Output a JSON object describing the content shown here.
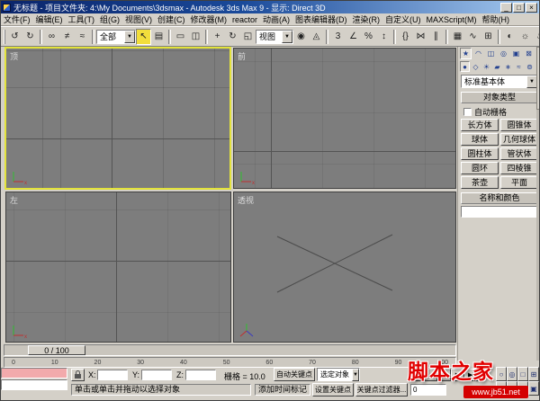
{
  "colors": {
    "titlebar_blue": "#0a246a",
    "active_tool_yellow": "#f2de3c",
    "active_viewport_border": "#e3e33a",
    "viewport_gray": "#7d7d7d",
    "ui_gray": "#d4d0c8",
    "watermark_red": "#d40000"
  },
  "window": {
    "title": "无标题 - 项目文件夹: 4:\\My Documents\\3dsmax - Autodesk 3ds Max 9 - 显示: Direct 3D",
    "minimize": "_",
    "maximize": "□",
    "close": "×"
  },
  "menu": {
    "items": [
      "文件(F)",
      "编辑(E)",
      "工具(T)",
      "组(G)",
      "视图(V)",
      "创建(C)",
      "修改器(M)",
      "reactor",
      "动画(A)",
      "图表编辑器(D)",
      "渲染(R)",
      "自定义(U)",
      "MAXScript(M)",
      "帮助(H)"
    ]
  },
  "toolbar": {
    "selection_filter": "全部",
    "coord_system": "视图",
    "dropdown_arrow": "▼",
    "icons": [
      {
        "name": "undo",
        "glyph": "↺"
      },
      {
        "name": "redo",
        "glyph": "↻"
      },
      {
        "name": "select-and-link",
        "glyph": "∞"
      },
      {
        "name": "unlink-selection",
        "glyph": "≠"
      },
      {
        "name": "bind-to-space-warp",
        "glyph": "≈"
      },
      {
        "name": "select-object",
        "glyph": "↖"
      },
      {
        "name": "select-by-name",
        "glyph": "▤"
      },
      {
        "name": "rectangular-selection-region",
        "glyph": "▭"
      },
      {
        "name": "window-crossing",
        "glyph": "◫"
      },
      {
        "name": "select-and-move",
        "glyph": "+"
      },
      {
        "name": "select-and-rotate",
        "glyph": "↻"
      },
      {
        "name": "select-and-scale",
        "glyph": "◱"
      },
      {
        "name": "use-pivot-point-center",
        "glyph": "◉"
      },
      {
        "name": "select-and-manipulate",
        "glyph": "◬"
      },
      {
        "name": "snap-toggle",
        "glyph": "3"
      },
      {
        "name": "angle-snap",
        "glyph": "∠"
      },
      {
        "name": "percent-snap",
        "glyph": "%"
      },
      {
        "name": "spinner-snap",
        "glyph": "↕"
      },
      {
        "name": "named-selection-sets",
        "glyph": "{}"
      },
      {
        "name": "mirror",
        "glyph": "⋈"
      },
      {
        "name": "align",
        "glyph": "∥"
      },
      {
        "name": "layer-manager",
        "glyph": "▦"
      },
      {
        "name": "curve-editor",
        "glyph": "∿"
      },
      {
        "name": "schematic-view",
        "glyph": "⊞"
      },
      {
        "name": "material-editor",
        "glyph": "◐"
      },
      {
        "name": "render-setup",
        "glyph": "☼"
      },
      {
        "name": "quick-render",
        "glyph": "♨"
      }
    ]
  },
  "viewports": [
    {
      "label": "顶"
    },
    {
      "label": "前"
    },
    {
      "label": "左"
    },
    {
      "label": "透视"
    }
  ],
  "command_panel": {
    "tabs": [
      {
        "name": "create",
        "glyph": "★"
      },
      {
        "name": "modify",
        "glyph": "◠"
      },
      {
        "name": "hierarchy",
        "glyph": "◫"
      },
      {
        "name": "motion",
        "glyph": "◎"
      },
      {
        "name": "display",
        "glyph": "▣"
      },
      {
        "name": "utilities",
        "glyph": "⊠"
      }
    ],
    "categories": [
      {
        "name": "geometry",
        "glyph": "●"
      },
      {
        "name": "shapes",
        "glyph": "◇"
      },
      {
        "name": "lights",
        "glyph": "☀"
      },
      {
        "name": "cameras",
        "glyph": "▰"
      },
      {
        "name": "helpers",
        "glyph": "∗"
      },
      {
        "name": "space-warps",
        "glyph": "≈"
      },
      {
        "name": "systems",
        "glyph": "⊚"
      }
    ],
    "category_dropdown": "标准基本体",
    "object_type_header": "对象类型",
    "autogrid_label": "自动栅格",
    "object_buttons": [
      "长方体",
      "圆锥体",
      "球体",
      "几何球体",
      "圆柱体",
      "管状体",
      "圆环",
      "四棱锥",
      "茶壶",
      "平面"
    ],
    "name_color_header": "名称和颜色",
    "name_value": ""
  },
  "timeline": {
    "slider_label": "0 / 100",
    "ticks": [
      "0",
      "10",
      "20",
      "30",
      "40",
      "50",
      "60",
      "70",
      "80",
      "90",
      "100"
    ]
  },
  "status": {
    "x_label": "X:",
    "y_label": "Y:",
    "z_label": "Z:",
    "x_value": "",
    "y_value": "",
    "z_value": "",
    "grid_label": "栅格 = 10.0",
    "prompt": "单击或单击并拖动以选择对象",
    "time_tag": "添加时间标记",
    "auto_key": "自动关键点",
    "set_key": "设置关键点",
    "selection_dropdown": "选定对象",
    "key_filters": "关键点过滤器...",
    "frame_value": "0",
    "transport": [
      {
        "name": "go-to-start",
        "glyph": "|◀"
      },
      {
        "name": "previous-frame",
        "glyph": "◀"
      },
      {
        "name": "play",
        "glyph": "▶"
      },
      {
        "name": "next-frame",
        "glyph": "▶"
      },
      {
        "name": "go-to-end",
        "glyph": "▶|"
      }
    ],
    "nav": [
      {
        "name": "zoom",
        "glyph": "○"
      },
      {
        "name": "zoom-all",
        "glyph": "◎"
      },
      {
        "name": "zoom-extents",
        "glyph": "□"
      },
      {
        "name": "zoom-extents-all",
        "glyph": "⊞"
      },
      {
        "name": "zoom-region",
        "glyph": "▭"
      },
      {
        "name": "pan",
        "glyph": "+"
      },
      {
        "name": "arc-rotate",
        "glyph": "↻"
      },
      {
        "name": "maximize-viewport-toggle",
        "glyph": "▣"
      }
    ]
  },
  "watermark": {
    "title": "脚本之家",
    "url": "www.jb51.net"
  }
}
